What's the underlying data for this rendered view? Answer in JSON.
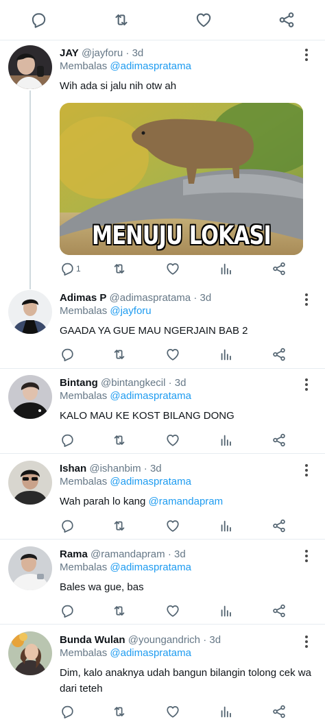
{
  "icons": {
    "reply": "reply-icon",
    "retweet": "retweet-icon",
    "like": "like-icon",
    "views": "views-icon",
    "share": "share-icon",
    "more": "more-icon"
  },
  "colors": {
    "link": "#1d9bf0",
    "secondary_text": "#657786",
    "divider": "#e6ecf0"
  },
  "tweets": [
    {
      "name": "JAY",
      "handle": "@jayforu",
      "time": "· 3d",
      "reply_prefix": "Membalas",
      "reply_to": "@adimaspratama",
      "text": "Wih ada si jalu nih otw ah",
      "media_caption": "MENUJU LOKASI",
      "reply_count": "1"
    },
    {
      "name": "Adimas P",
      "handle": "@adimaspratama",
      "time": "· 3d",
      "reply_prefix": "Membalas",
      "reply_to": "@jayforu",
      "text": "GAADA YA GUE MAU NGERJAIN BAB 2"
    },
    {
      "name": "Bintang",
      "handle": "@bintangkecil",
      "time": "· 3d",
      "reply_prefix": "Membalas",
      "reply_to": "@adimaspratama",
      "text": "KALO MAU KE KOST BILANG DONG"
    },
    {
      "name": "Ishan",
      "handle": "@ishanbim",
      "time": "· 3d",
      "reply_prefix": "Membalas",
      "reply_to": "@adimaspratama",
      "text_before": "Wah parah lo kang ",
      "text_mention": "@ramandapram"
    },
    {
      "name": "Rama",
      "handle": "@ramandapram",
      "time": "· 3d",
      "reply_prefix": "Membalas",
      "reply_to": "@adimaspratama",
      "text": "Bales wa gue, bas"
    },
    {
      "name": "Bunda Wulan",
      "handle": "@youngandrich",
      "time": "· 3d",
      "reply_prefix": "Membalas",
      "reply_to": "@adimaspratama",
      "text": "Dim, kalo anaknya udah bangun bilangin tolong cek wa dari teteh"
    }
  ]
}
